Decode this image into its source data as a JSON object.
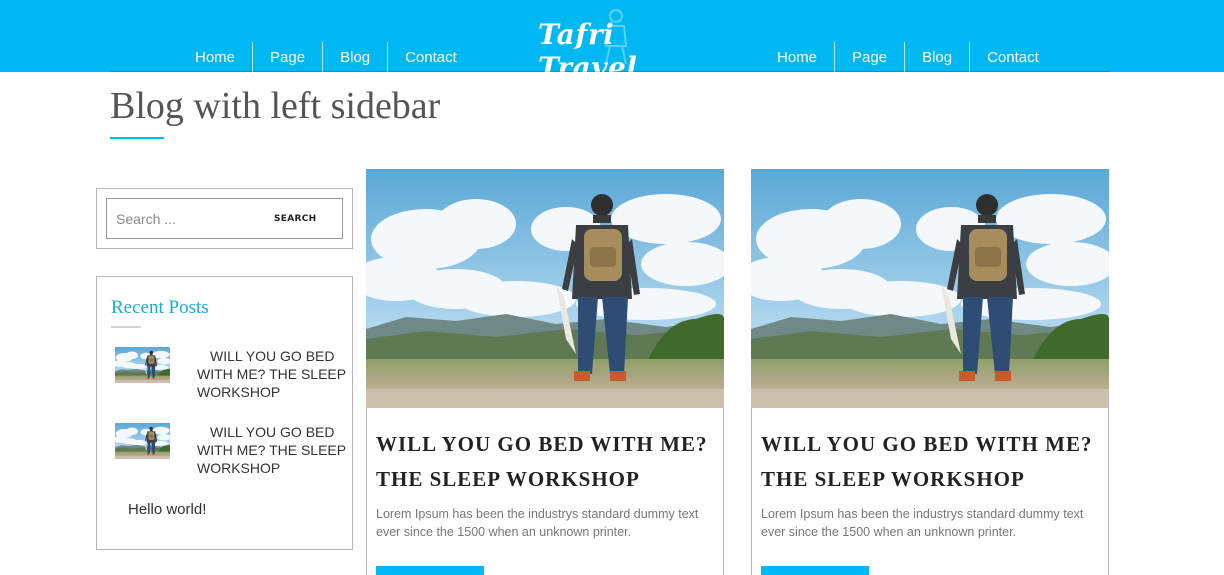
{
  "header": {
    "brand": "Tafri Travel",
    "nav_left": [
      "Home",
      "Page",
      "Blog",
      "Contact"
    ],
    "nav_right": [
      "Home",
      "Page",
      "Blog",
      "Contact"
    ],
    "color": "#00b8f1"
  },
  "page": {
    "title": "Blog with left sidebar"
  },
  "sidebar": {
    "search": {
      "placeholder": "Search ...",
      "button_label": "SEARCH"
    },
    "recent": {
      "title": "Recent Posts",
      "items": [
        {
          "label": "WILL YOU GO BED WITH ME? THE SLEEP WORKSHOP"
        },
        {
          "label": "WILL YOU GO BED WITH ME? THE SLEEP WORKSHOP"
        }
      ],
      "text_item": "Hello world!"
    }
  },
  "posts": [
    {
      "title": "WILL YOU GO BED WITH ME? THE SLEEP WORKSHOP",
      "excerpt": "Lorem Ipsum has been the industrys standard dummy text ever since the 1500 when an unknown printer."
    },
    {
      "title": "WILL YOU GO BED WITH ME? THE SLEEP WORKSHOP",
      "excerpt": "Lorem Ipsum has been the industrys standard dummy text ever since the 1500 when an unknown printer."
    }
  ]
}
